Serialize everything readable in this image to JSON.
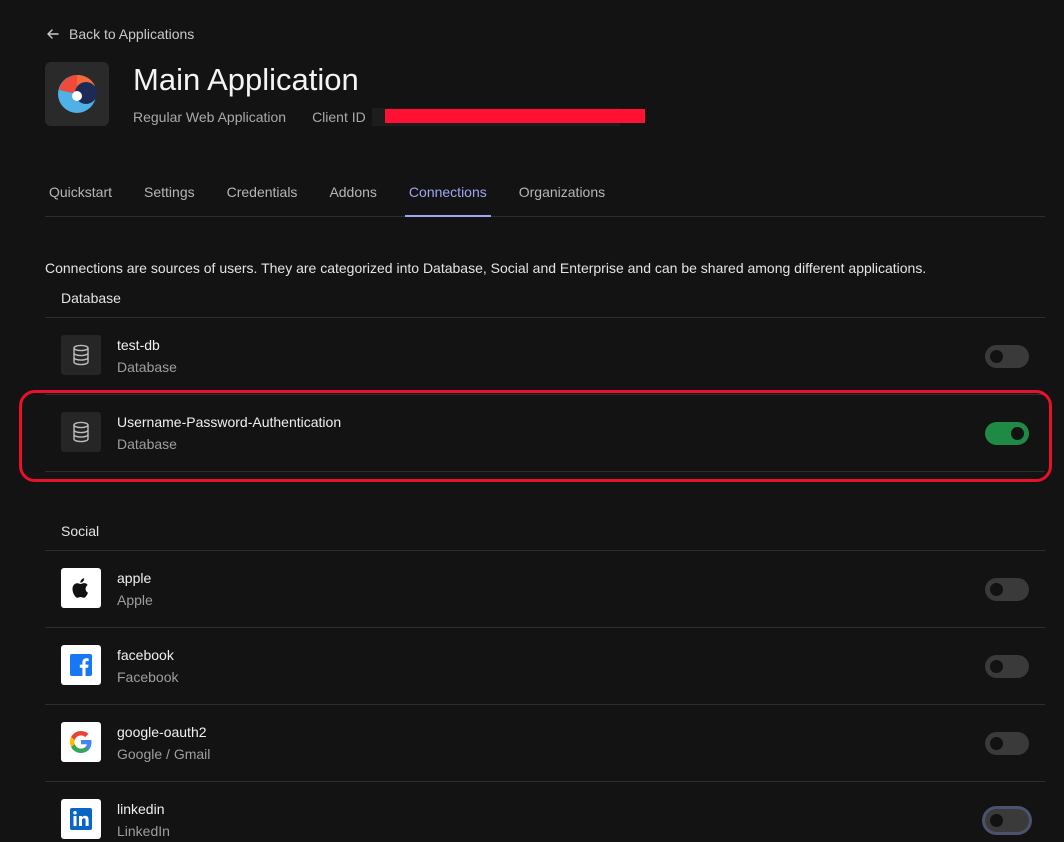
{
  "back": {
    "label": "Back to Applications"
  },
  "app": {
    "title": "Main Application",
    "type": "Regular Web Application",
    "client_id_label": "Client ID"
  },
  "tabs": [
    {
      "label": "Quickstart",
      "active": false
    },
    {
      "label": "Settings",
      "active": false
    },
    {
      "label": "Credentials",
      "active": false
    },
    {
      "label": "Addons",
      "active": false
    },
    {
      "label": "Connections",
      "active": true
    },
    {
      "label": "Organizations",
      "active": false
    }
  ],
  "description": "Connections are sources of users. They are categorized into Database, Social and Enterprise and can be shared among different applications.",
  "database": {
    "label": "Database",
    "items": [
      {
        "name": "test-db",
        "type": "Database",
        "enabled": false,
        "icon": "database-icon"
      },
      {
        "name": "Username-Password-Authentication",
        "type": "Database",
        "enabled": true,
        "icon": "database-icon"
      }
    ]
  },
  "social": {
    "label": "Social",
    "items": [
      {
        "name": "apple",
        "type": "Apple",
        "enabled": false,
        "icon": "apple-icon"
      },
      {
        "name": "facebook",
        "type": "Facebook",
        "enabled": false,
        "icon": "facebook-icon"
      },
      {
        "name": "google-oauth2",
        "type": "Google / Gmail",
        "enabled": false,
        "icon": "google-icon"
      },
      {
        "name": "linkedin",
        "type": "LinkedIn",
        "enabled": false,
        "icon": "linkedin-icon"
      }
    ]
  },
  "colors": {
    "accent": "#9fa6f5",
    "toggle_on": "#1e8a46",
    "highlight": "#e8102b",
    "redaction": "#ff1133"
  }
}
